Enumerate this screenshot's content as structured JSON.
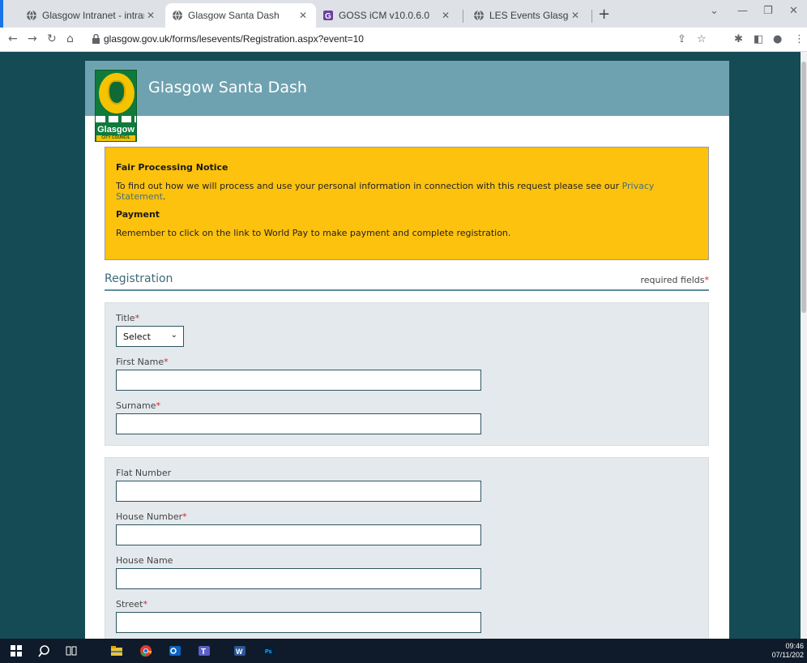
{
  "browser": {
    "tabs": [
      {
        "title": "Glasgow Intranet - intranet Hom",
        "active": false
      },
      {
        "title": "Glasgow Santa Dash",
        "active": true
      },
      {
        "title": "GOSS iCM v10.0.6.0",
        "active": false
      },
      {
        "title": "LES Events Glasgow",
        "active": false
      }
    ],
    "url": "glasgow.gov.uk/forms/lesevents/Registration.aspx?event=10"
  },
  "page": {
    "banner_title": "Glasgow Santa Dash",
    "logo_text": "Glasgow",
    "logo_subtext": "CITY COUNCIL",
    "notice": {
      "heading1": "Fair Processing Notice",
      "text1": "To find out how we will process and use your personal information in connection with this request please see our",
      "link1": "Privacy Statement",
      "text1_end": ".",
      "heading2": "Payment",
      "text2": "Remember to click on the link to World Pay to make payment and complete registration."
    },
    "registration": {
      "title": "Registration",
      "required_note": "required fields",
      "required_star": "*"
    },
    "fields": {
      "title_label": "Title",
      "title_value": "Select",
      "first_name_label": "First Name",
      "surname_label": "Surname",
      "flat_number_label": "Flat Number",
      "house_number_label": "House Number",
      "house_name_label": "House Name",
      "street_label": "Street"
    }
  },
  "taskbar": {
    "time": "09:46",
    "date": "07/11/202"
  }
}
